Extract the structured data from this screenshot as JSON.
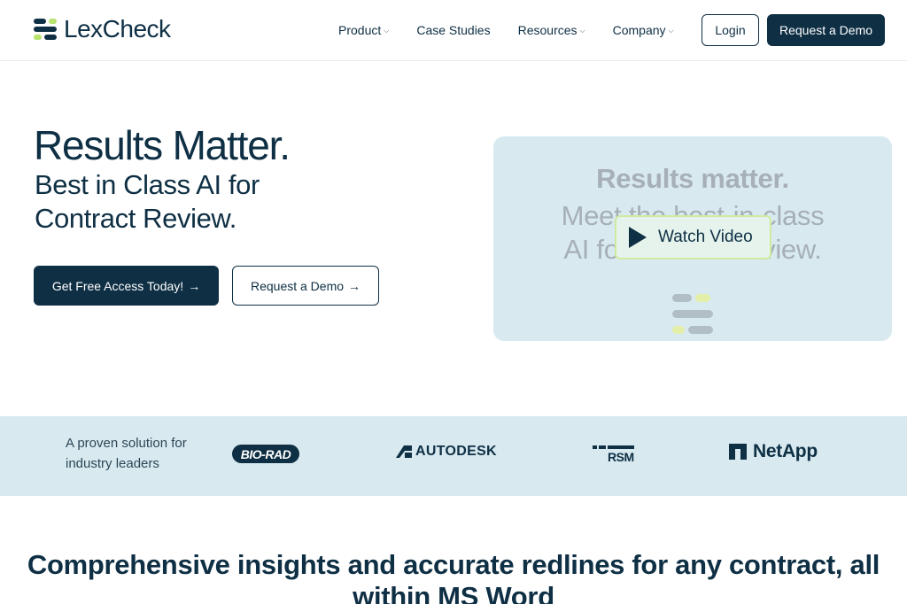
{
  "brand": {
    "name": "LexCheck",
    "colors": {
      "navy": "#0e2f44",
      "lime": "#b7e36e",
      "light_blue": "#d8eaf0"
    }
  },
  "nav": {
    "items": [
      {
        "label": "Product",
        "has_dropdown": true
      },
      {
        "label": "Case Studies",
        "has_dropdown": false
      },
      {
        "label": "Resources",
        "has_dropdown": true
      },
      {
        "label": "Company",
        "has_dropdown": true
      }
    ],
    "login_label": "Login",
    "demo_label": "Request a Demo"
  },
  "hero": {
    "title": "Results Matter.",
    "subtitle": "Best in Class AI for Contract Review.",
    "cta_primary": "Get Free Access Today!",
    "cta_secondary": "Request a Demo",
    "arrow": "→"
  },
  "video": {
    "line1": "Results matter.",
    "line2": "Meet the best-in-class",
    "line3": "AI for contract review.",
    "button_label": "Watch Video"
  },
  "logos": {
    "intro": "A proven solution for industry leaders",
    "items": [
      "BIO-RAD",
      "AUTODESK",
      "RSM",
      "NetApp"
    ]
  },
  "section": {
    "title": "Comprehensive insights and accurate redlines for any contract, all within MS Word"
  }
}
